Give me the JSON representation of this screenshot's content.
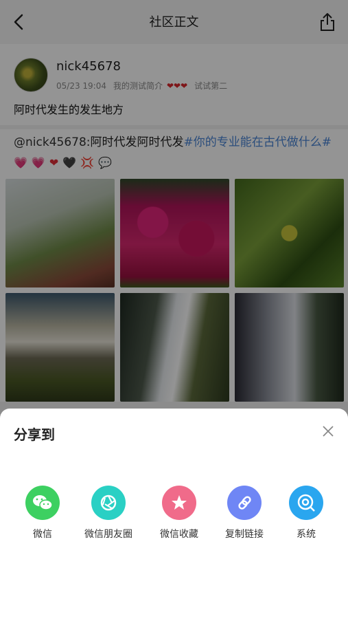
{
  "header": {
    "title": "社区正文"
  },
  "post": {
    "username": "nick45678",
    "date": "05/23 19:04",
    "bio": "我的测试简介",
    "bio_hearts": "❤❤❤",
    "extra": "试试第二",
    "title": "阿时代发生的发生地方",
    "mention": "@nick45678",
    "text": ":阿时代发阿时代发",
    "hashtag": "#你的专业能在古代做什么#",
    "emojis": {
      "pink1": "💗",
      "pink2": "💗",
      "red": "❤",
      "black": "🖤",
      "anger": "💢",
      "bubble": "💬"
    },
    "images": [
      "dune-grass-photo",
      "pink-flowers-photo",
      "leaves-photo",
      "waterfall-photo",
      "rushing-water-photo",
      "waterfall-cliff-photo"
    ]
  },
  "share_sheet": {
    "title": "分享到",
    "targets": [
      {
        "label": "微信",
        "icon": "wechat-icon",
        "color": "#3dd061"
      },
      {
        "label": "微信朋友圈",
        "icon": "moments-icon",
        "color": "#2ad0c4"
      },
      {
        "label": "微信收藏",
        "icon": "favorite-star-icon",
        "color": "#f06b8a"
      },
      {
        "label": "复制链接",
        "icon": "link-icon",
        "color": "#6f86f5"
      },
      {
        "label": "系统",
        "icon": "system-share-icon",
        "color": "#2aa6ef"
      }
    ]
  }
}
